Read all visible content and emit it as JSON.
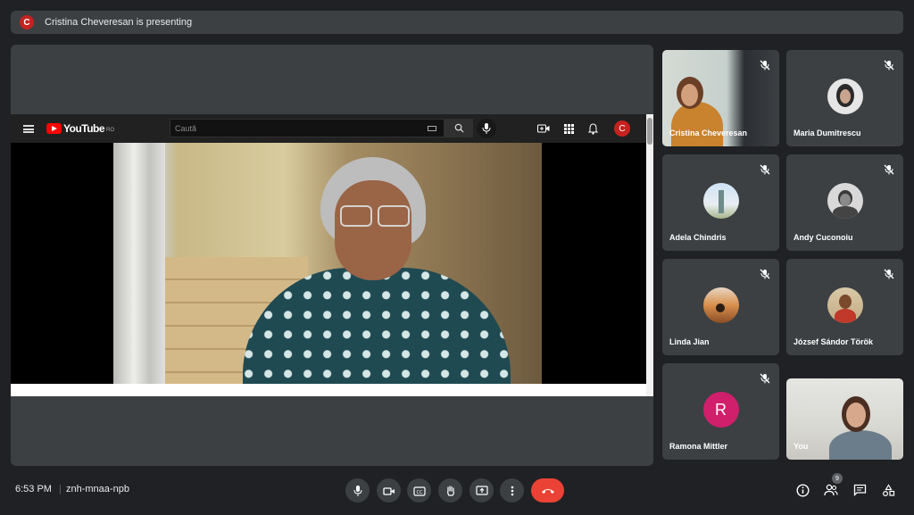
{
  "presenting_bar": {
    "avatar_letter": "C",
    "text": "Cristina Cheveresan is presenting"
  },
  "youtube": {
    "wordmark": "YouTube",
    "region": "RO",
    "search_placeholder": "Caută",
    "avatar_letter": "C"
  },
  "participants": [
    {
      "name": "Cristina Cheveresan",
      "muted": true,
      "type": "camera"
    },
    {
      "name": "Maria Dumitrescu",
      "muted": true,
      "type": "avatar"
    },
    {
      "name": "Adela Chindris",
      "muted": true,
      "type": "avatar"
    },
    {
      "name": "Andy Cuconoiu",
      "muted": true,
      "type": "avatar"
    },
    {
      "name": "Linda Jian",
      "muted": true,
      "type": "avatar"
    },
    {
      "name": "József Sándor Török",
      "muted": true,
      "type": "avatar"
    },
    {
      "name": "Ramona Mittler",
      "muted": true,
      "type": "letter",
      "letter": "R",
      "color": "#d01f6b"
    },
    {
      "name": "You",
      "muted": false,
      "type": "camera"
    }
  ],
  "bottom_bar": {
    "time": "6:53 PM",
    "separator": "|",
    "meeting_code": "znh-mnaa-npb",
    "people_count": "9"
  },
  "colors": {
    "end_call": "#ea4335",
    "background": "#202124",
    "tile": "#3c4043"
  }
}
